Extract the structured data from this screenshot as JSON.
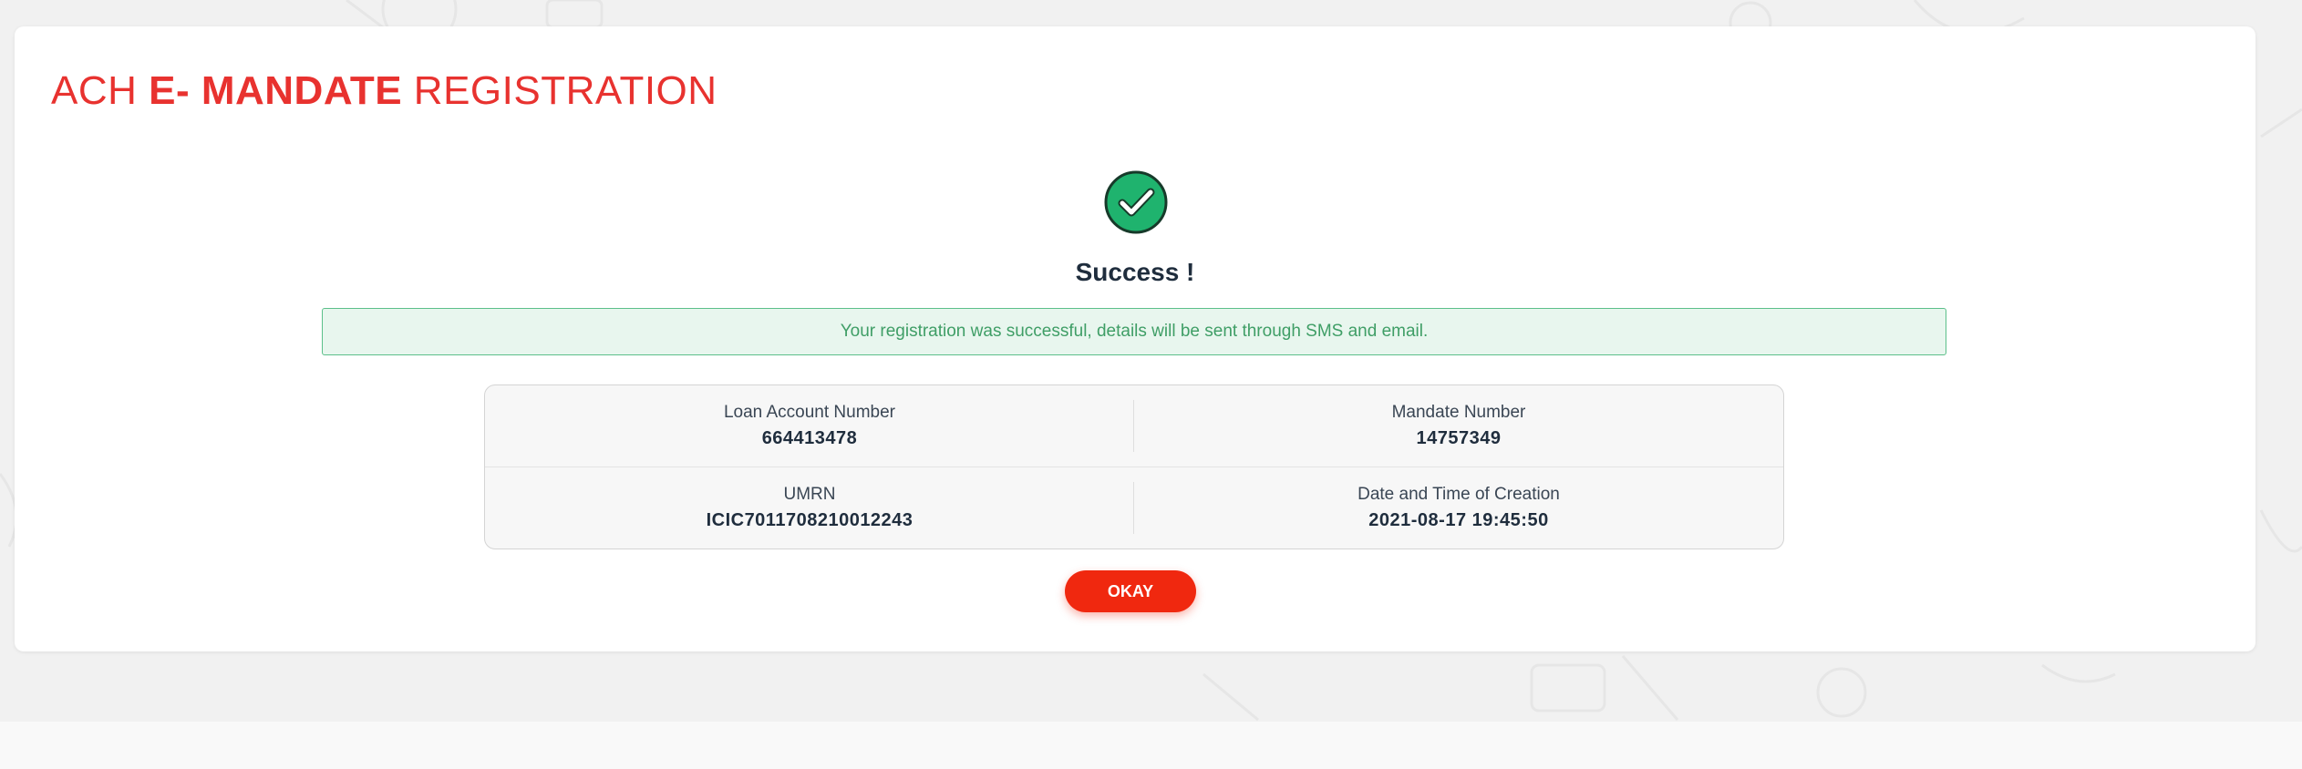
{
  "header": {
    "title_prefix": "ACH ",
    "title_bold": "E- MANDATE",
    "title_suffix": " REGISTRATION"
  },
  "status": {
    "icon": "check-circle-icon",
    "heading": "Success !",
    "message": "Your registration was successful, details will be sent through SMS and email."
  },
  "details": {
    "loan_account": {
      "label": "Loan Account Number",
      "value": "664413478"
    },
    "mandate_number": {
      "label": "Mandate Number",
      "value": "14757349"
    },
    "umrn": {
      "label": "UMRN",
      "value": "ICIC7011708210012243"
    },
    "created_at": {
      "label": "Date and Time of Creation",
      "value": "2021-08-17 19:45:50"
    }
  },
  "actions": {
    "okay_label": "OKAY"
  },
  "colors": {
    "brand_red": "#e8322f",
    "button_red": "#f0280f",
    "success_green": "#1fb36e",
    "alert_bg": "#e8f6ee"
  }
}
